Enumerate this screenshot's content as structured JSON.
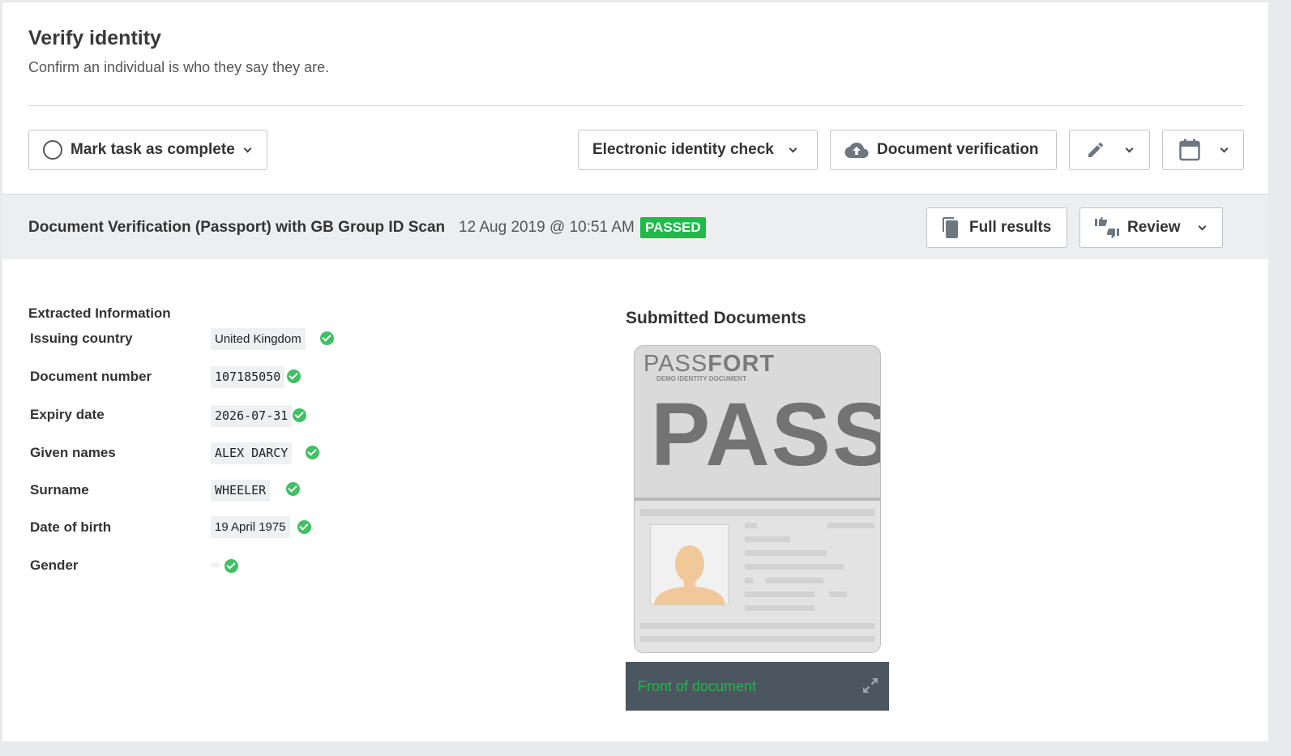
{
  "header": {
    "title": "Verify identity",
    "subtitle": "Confirm an individual is who they say they are."
  },
  "toolbar": {
    "mark_complete_label": "Mark task as complete",
    "eid_check_label": "Electronic identity check",
    "doc_verification_label": "Document verification",
    "edit_icon": "pencil-icon",
    "calendar_icon": "calendar-icon"
  },
  "result": {
    "title": "Document Verification (Passport) with GB Group ID Scan",
    "timestamp": "12 Aug 2019 @ 10:51 AM",
    "status": "PASSED",
    "full_results_label": "Full results",
    "review_label": "Review"
  },
  "extracted": {
    "section_title": "Extracted Information",
    "rows": [
      {
        "label": "Issuing country",
        "value": "United Kingdom"
      },
      {
        "label": "Document number",
        "value": "107185050"
      },
      {
        "label": "Expiry date",
        "value": "2026-07-31"
      },
      {
        "label": "Given names",
        "value": "ALEX DARCY"
      },
      {
        "label": "Surname",
        "value": "WHEELER"
      },
      {
        "label": "Date of birth",
        "value": "19 April 1975"
      },
      {
        "label": "Gender",
        "value": ""
      }
    ]
  },
  "documents": {
    "title": "Submitted Documents",
    "passport_brand_a": "PASS",
    "passport_brand_b": "FORT",
    "passport_subtitle": "DEMO IDENTITY DOCUMENT",
    "passport_big": "PASS",
    "caption": "Front of document"
  },
  "colors": {
    "accent_green": "#1fba4a",
    "caption_bg": "#4b5660",
    "result_bar_bg": "#eceef0"
  }
}
